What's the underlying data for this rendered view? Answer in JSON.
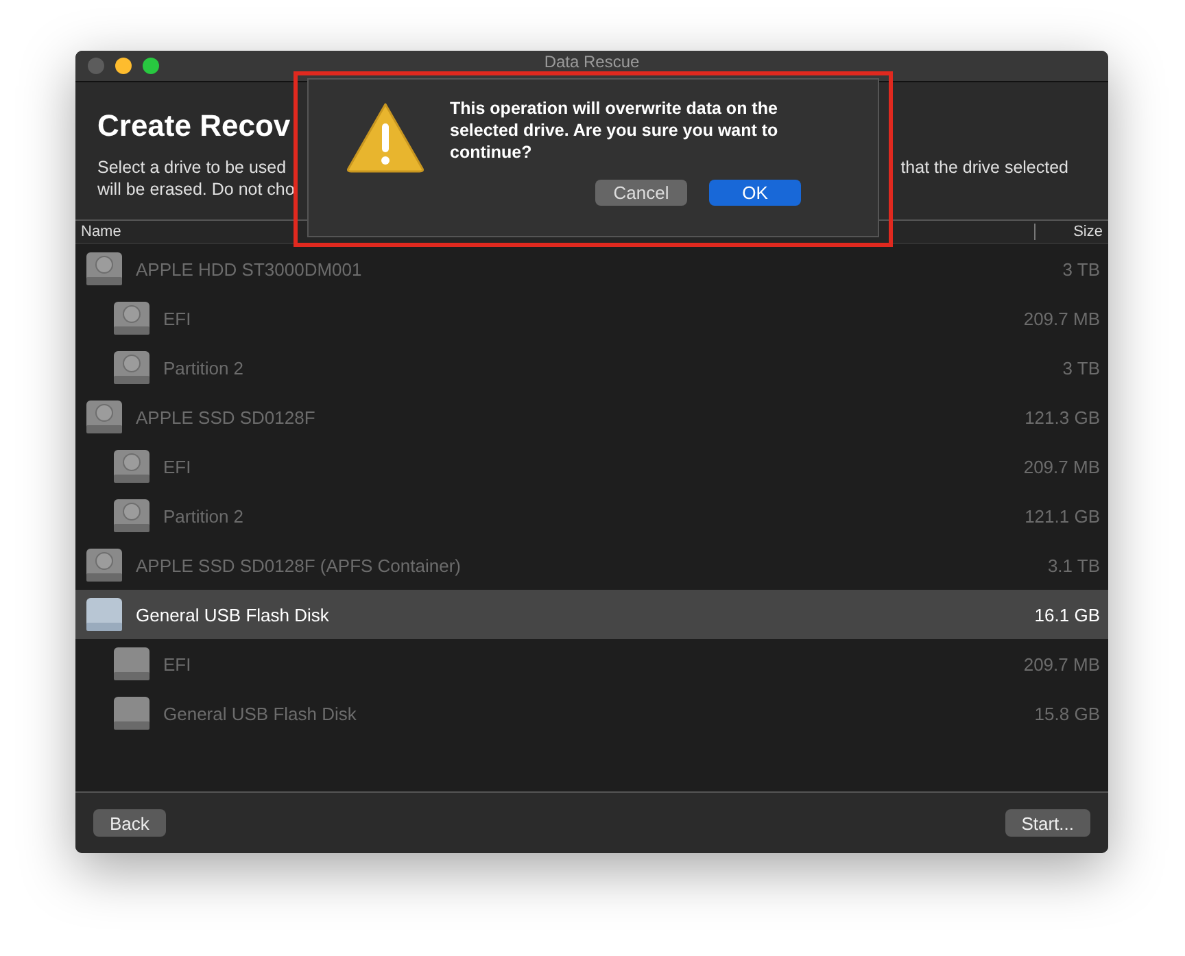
{
  "window": {
    "title": "Data Rescue"
  },
  "heading": "Create Recov",
  "description": {
    "left_lines": [
      "Select a drive to be used",
      "will be erased. Do not cho"
    ],
    "right_fragment": "that the drive selected"
  },
  "table": {
    "columns": [
      "Name",
      "Size"
    ],
    "rows": [
      {
        "name": "APPLE HDD ST3000DM001",
        "size": "3 TB",
        "kind": "hdd",
        "selected": false,
        "disabled": true,
        "children": [
          {
            "name": "EFI",
            "size": "209.7 MB",
            "kind": "hdd",
            "selected": false,
            "disabled": true
          },
          {
            "name": "Partition 2",
            "size": "3 TB",
            "kind": "hdd",
            "selected": false,
            "disabled": true
          }
        ]
      },
      {
        "name": "APPLE SSD SD0128F",
        "size": "121.3 GB",
        "kind": "hdd",
        "selected": false,
        "disabled": true,
        "children": [
          {
            "name": "EFI",
            "size": "209.7 MB",
            "kind": "hdd",
            "selected": false,
            "disabled": true
          },
          {
            "name": "Partition 2",
            "size": "121.1 GB",
            "kind": "hdd",
            "selected": false,
            "disabled": true
          }
        ]
      },
      {
        "name": "APPLE SSD SD0128F (APFS Container)",
        "size": "3.1 TB",
        "kind": "hdd",
        "selected": false,
        "disabled": true
      },
      {
        "name": "General USB Flash Disk",
        "size": "16.1 GB",
        "kind": "usb",
        "selected": true,
        "disabled": false,
        "children": [
          {
            "name": "EFI",
            "size": "209.7 MB",
            "kind": "volume",
            "selected": false,
            "disabled": true
          },
          {
            "name": "General USB Flash Disk",
            "size": "15.8 GB",
            "kind": "volume",
            "selected": false,
            "disabled": true
          }
        ]
      }
    ]
  },
  "footer": {
    "back_button": "Back",
    "start_button": "Start..."
  },
  "alert": {
    "message": "This operation will overwrite data on the selected drive. Are you sure you want to continue?",
    "buttons": [
      {
        "label": "Cancel",
        "default": false
      },
      {
        "label": "OK",
        "default": true
      }
    ]
  }
}
